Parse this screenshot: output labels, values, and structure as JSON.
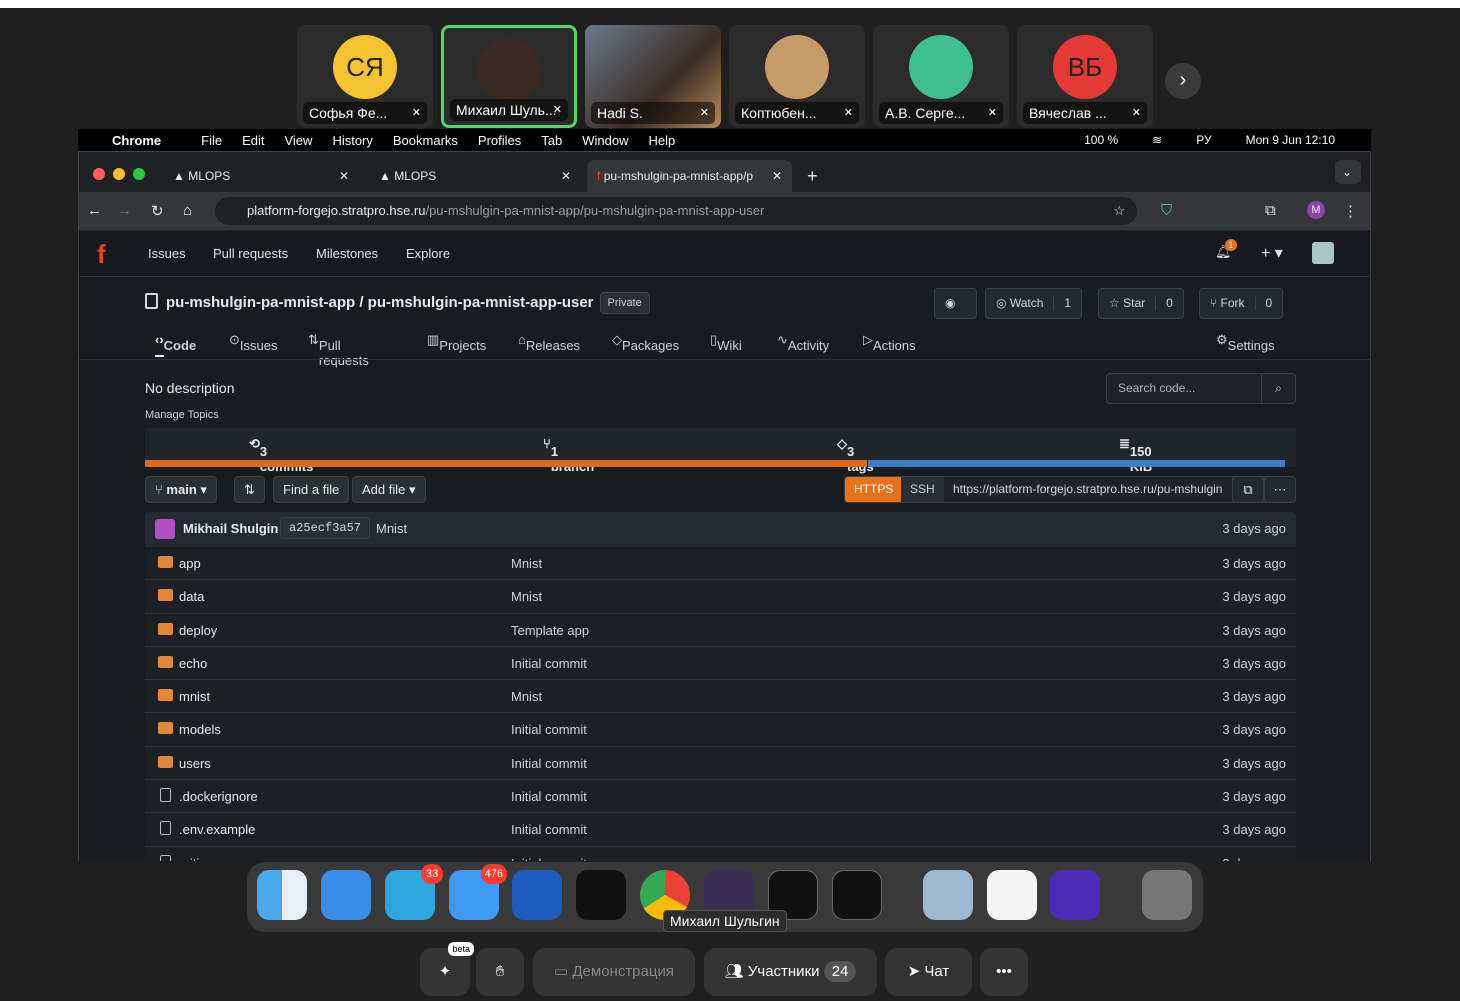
{
  "conference": {
    "participants": [
      {
        "name": "Софья Фе...",
        "initials": "СЯ",
        "color": "#f4c430"
      },
      {
        "name": "Михаил Шуль...",
        "initials": "",
        "color": "#3a2a22"
      },
      {
        "name": "Hadi S.",
        "initials": "",
        "color": "#555"
      },
      {
        "name": "Коптюбен...",
        "initials": "",
        "color": "#c79a6a"
      },
      {
        "name": "А.В. Серге...",
        "initials": "",
        "color": "#3fbf8f"
      },
      {
        "name": "Вячеслав ...",
        "initials": "ВБ",
        "color": "#e53935"
      }
    ],
    "next_icon": "chevron-right-icon",
    "tooltip": "Михаил Шульгин"
  },
  "menubar": {
    "app": "Chrome",
    "items": [
      "File",
      "Edit",
      "View",
      "History",
      "Bookmarks",
      "Profiles",
      "Tab",
      "Window",
      "Help"
    ],
    "battery": "100 %",
    "lang": "РУ",
    "clock": "Mon 9 Jun  12:10"
  },
  "browser": {
    "tabs": [
      {
        "label": "MLOPS"
      },
      {
        "label": "MLOPS"
      },
      {
        "label": "pu-mshulgin-pa-mnist-app/p"
      }
    ],
    "url_host": "platform-forgejo.stratpro.hse.ru",
    "url_path": "/pu-mshulgin-pa-mnist-app/pu-mshulgin-pa-mnist-app-user",
    "profile_initial": "M"
  },
  "forge": {
    "nav": [
      "Issues",
      "Pull requests",
      "Milestones",
      "Explore"
    ],
    "notif_count": "1",
    "owner": "pu-mshulgin-pa-mnist-app",
    "sep": " / ",
    "repo": "pu-mshulgin-pa-mnist-app-user",
    "visibility": "Private",
    "watch_label": "Watch",
    "watch_count": "1",
    "star_label": "Star",
    "star_count": "0",
    "fork_label": "Fork",
    "fork_count": "0",
    "tabs": [
      "Code",
      "Issues",
      "Pull requests",
      "Projects",
      "Releases",
      "Packages",
      "Wiki",
      "Activity",
      "Actions"
    ],
    "settings": "Settings",
    "description": "No description",
    "topics": "Manage Topics",
    "search_placeholder": "Search code...",
    "stats": {
      "commits": "3 commits",
      "branches": "1 branch",
      "tags": "3 tags",
      "size": "150 KiB"
    },
    "lang_orange": "#dd6a1a",
    "lang_blue": "#3c7dc3",
    "branch": "main",
    "find_file": "Find a file",
    "add_file": "Add file",
    "clone_https": "HTTPS",
    "clone_ssh": "SSH",
    "clone_url": "https://platform-forgejo.stratpro.hse.ru/pu-mshulgin",
    "last_commit": {
      "author": "Mikhail Shulgin",
      "sha": "a25ecf3a57",
      "message": "Mnist",
      "time": "3 days ago"
    },
    "files": [
      {
        "name": "app",
        "type": "folder",
        "msg": "Mnist",
        "time": "3 days ago"
      },
      {
        "name": "data",
        "type": "folder",
        "msg": "Mnist",
        "time": "3 days ago"
      },
      {
        "name": "deploy",
        "type": "folder",
        "msg": "Template app",
        "time": "3 days ago"
      },
      {
        "name": "echo",
        "type": "folder",
        "msg": "Initial commit",
        "time": "3 days ago"
      },
      {
        "name": "mnist",
        "type": "folder",
        "msg": "Mnist",
        "time": "3 days ago"
      },
      {
        "name": "models",
        "type": "folder",
        "msg": "Initial commit",
        "time": "3 days ago"
      },
      {
        "name": "users",
        "type": "folder",
        "msg": "Initial commit",
        "time": "3 days ago"
      },
      {
        "name": ".dockerignore",
        "type": "file",
        "msg": "Initial commit",
        "time": "3 days ago"
      },
      {
        "name": ".env.example",
        "type": "file",
        "msg": "Initial commit",
        "time": "3 days ago"
      },
      {
        "name": ".gitignore",
        "type": "file",
        "msg": "Initial commit",
        "time": "3 days ago"
      }
    ]
  },
  "dock": {
    "telegram_badge": "33",
    "mail_badge": "476"
  },
  "controls": {
    "beta": "beta",
    "demo": "Демонстрация",
    "participants": "Участники",
    "participants_count": "24",
    "chat": "Чат"
  }
}
